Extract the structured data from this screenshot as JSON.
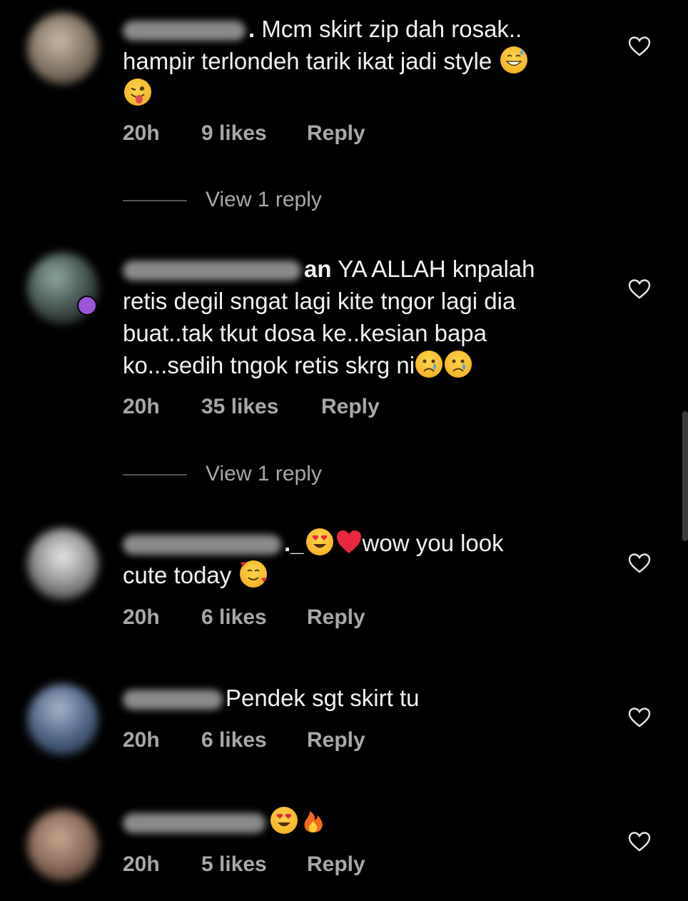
{
  "comments": [
    {
      "name_trail": ".",
      "text_line1": "Mcm skirt zip dah rosak..",
      "text_line2": "hampir terlondeh tarik ikat jadi style",
      "time": "20h",
      "likes": "9 likes",
      "reply": "Reply",
      "view_replies": "View 1 reply",
      "emojis": [
        "grinning-sweat-emoji",
        "winking-tongue-emoji"
      ]
    },
    {
      "name_trail": "an",
      "text_line1": "YA ALLAH knpalah",
      "text_line2": "retis degil sngat lagi kite tngor lagi dia",
      "text_line3": "buat..tak tkut dosa ke..kesian bapa",
      "text_line4": "ko...sedih tngok retis skrg ni",
      "time": "20h",
      "likes": "35 likes",
      "reply": "Reply",
      "view_replies": "View 1 reply",
      "emojis": [
        "crying-face-emoji",
        "crying-face-emoji"
      ]
    },
    {
      "name_trail": "._",
      "text_line1": "wow you look",
      "text_line2": "cute today",
      "time": "20h",
      "likes": "6 likes",
      "reply": "Reply",
      "emojis": [
        "heart-eyes-emoji",
        "red-heart-emoji",
        "smiling-hearts-emoji"
      ]
    },
    {
      "name_trail": "",
      "text_line1": "Pendek sgt skirt tu",
      "time": "20h",
      "likes": "6 likes",
      "reply": "Reply"
    },
    {
      "name_trail": "",
      "time": "20h",
      "likes": "5 likes",
      "reply": "Reply",
      "emojis": [
        "heart-eyes-emoji",
        "fire-emoji"
      ]
    }
  ],
  "colors": {
    "background": "#000000",
    "text": "#f2f2f2",
    "meta": "#a8a8a8",
    "emoji_yellow": "#f7c23a",
    "heart_red": "#e8283c"
  },
  "icons": [
    "heart-outline-icon"
  ]
}
